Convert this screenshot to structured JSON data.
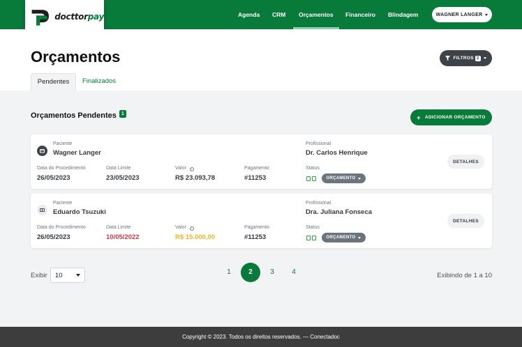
{
  "brand": {
    "name_main": "docttor",
    "name_accent": "pay",
    "accent_color": "#087a3a"
  },
  "nav": {
    "items": [
      {
        "label": "Agenda"
      },
      {
        "label": "CRM"
      },
      {
        "label": "Orçamentos",
        "active": true
      },
      {
        "label": "Financeiro"
      },
      {
        "label": "Blindagem"
      }
    ],
    "user_label": "WAGNER LANGER"
  },
  "page": {
    "title": "Orçamentos",
    "filter_label": "FILTROS",
    "filter_count": "2",
    "tabs": [
      {
        "label": "Pendentes",
        "active": true
      },
      {
        "label": "Finalizados"
      }
    ]
  },
  "section": {
    "title": "Orçamentos Pendentes",
    "count": "1",
    "add_label": "ADICIONAR ORÇAMENTO"
  },
  "labels": {
    "patient": "Paciente",
    "professional": "Profissional",
    "procedure_date": "Data do Procedimento",
    "limit_date": "Data Limite",
    "value": "Valor",
    "payment": "Pagamento",
    "status": "Status",
    "details": "DETALHES"
  },
  "cards": [
    {
      "icon": "wallet-icon",
      "patient": "Wagner Langer",
      "professional": "Dr. Carlos Henrique",
      "procedure_date": "26/05/2023",
      "limit_date": "23/05/2023",
      "value": "R$ 23.093,78",
      "payment": "#11253",
      "status": "ORÇAMENTO"
    },
    {
      "icon": "money-icon",
      "patient": "Eduardo Tsuzuki",
      "professional": "Dra. Juliana Fonseca",
      "procedure_date": "26/05/2023",
      "limit_date": "10/05/2022",
      "limit_date_color": "#dc3545",
      "value": "R$ 15.000,00",
      "value_color": "#f0b323",
      "payment": "#11253",
      "status": "ORÇAMENTO"
    }
  ],
  "pagination": {
    "show_label": "Exibir",
    "page_size": "10",
    "pages": [
      "1",
      "2",
      "3",
      "4"
    ],
    "current_page": "2",
    "summary": "Exibindo de 1 a 10"
  },
  "footer": {
    "text": "Copyright © 2023. Todos os direitos reservados. — Conectadoc"
  }
}
